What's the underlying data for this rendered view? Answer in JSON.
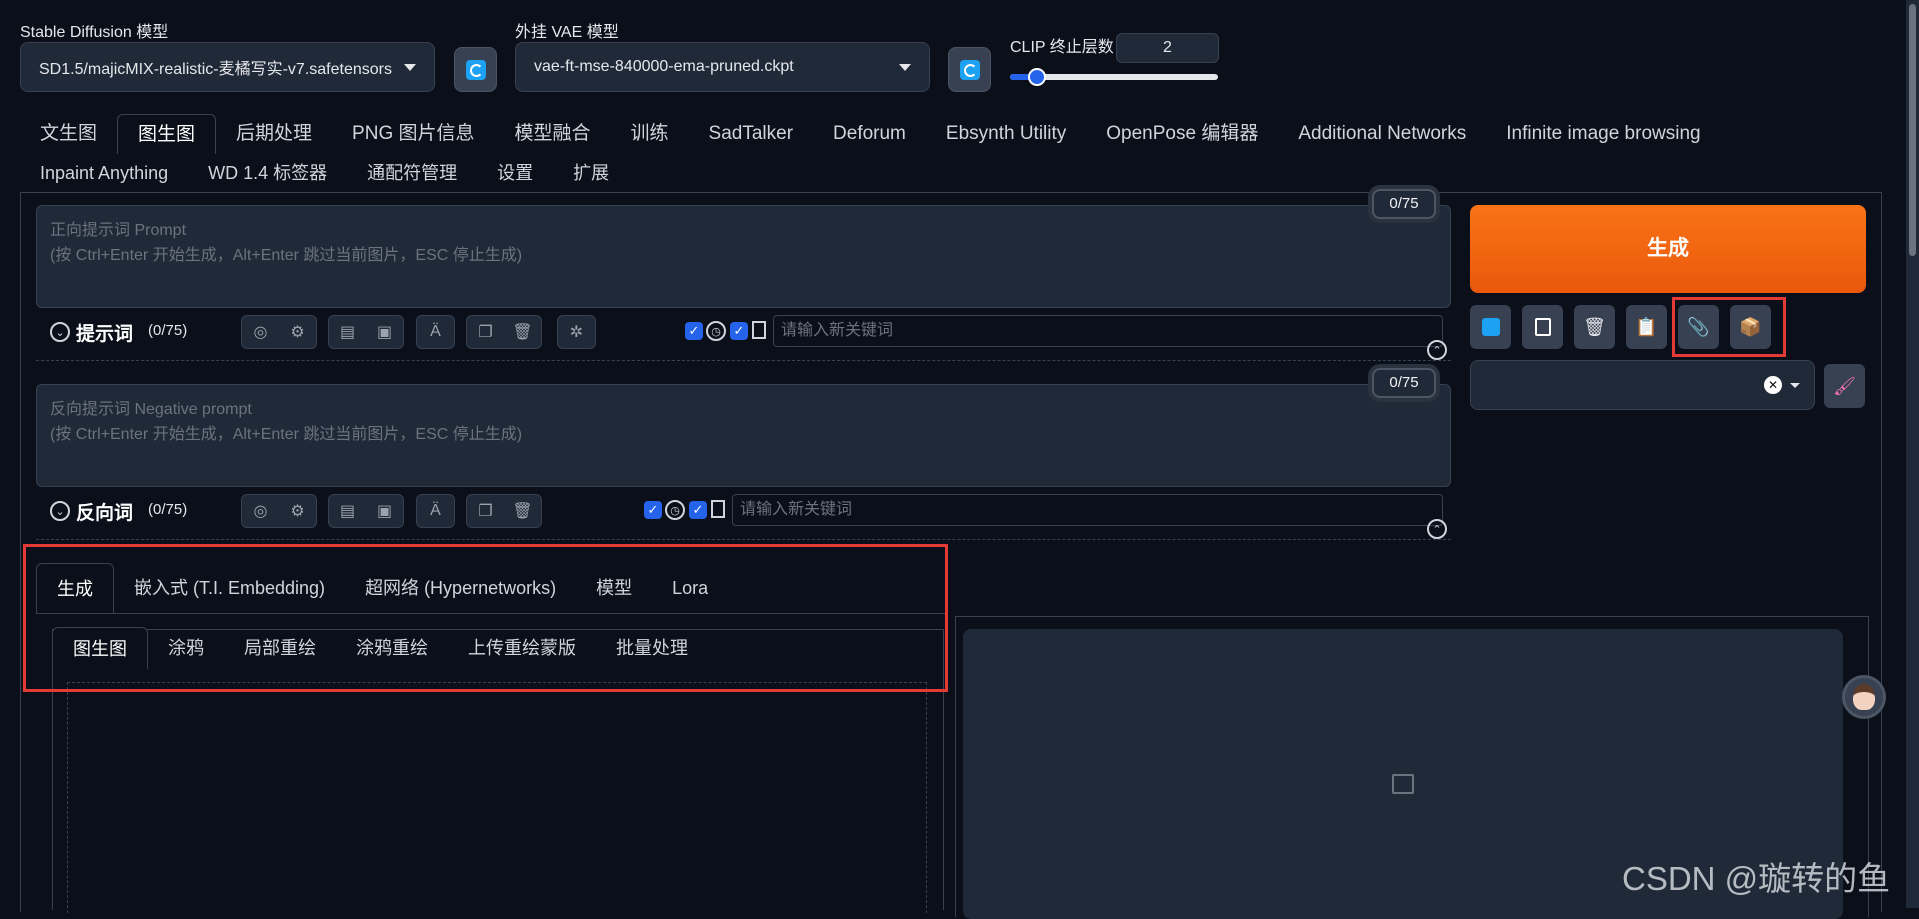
{
  "model": {
    "label": "Stable Diffusion 模型",
    "value": "SD1.5/majicMIX-realistic-麦橘写实-v7.safetensors"
  },
  "vae": {
    "label": "外挂 VAE 模型",
    "value": "vae-ft-mse-840000-ema-pruned.ckpt"
  },
  "clip": {
    "label": "CLIP 终止层数",
    "value": "2",
    "fraction": 0.13
  },
  "tabs_row1": [
    "文生图",
    "图生图",
    "后期处理",
    "PNG 图片信息",
    "模型融合",
    "训练",
    "SadTalker",
    "Deforum",
    "Ebsynth Utility",
    "OpenPose 编辑器",
    "Additional Networks",
    "Infinite image browsing"
  ],
  "tabs_row2": [
    "Inpaint Anything",
    "WD 1.4 标签器",
    "通配符管理",
    "设置",
    "扩展"
  ],
  "active_tab": "图生图",
  "prompt": {
    "placeholder_line1": "正向提示词 Prompt",
    "placeholder_line2": "(按 Ctrl+Enter 开始生成，Alt+Enter 跳过当前图片，ESC 停止生成)",
    "counter": "0/75",
    "title": "提示词",
    "count": "(0/75)",
    "keyword_placeholder": "请输入新关键词"
  },
  "negative": {
    "placeholder_line1": "反向提示词 Negative prompt",
    "placeholder_line2": "(按 Ctrl+Enter 开始生成，Alt+Enter 跳过当前图片，ESC 停止生成)",
    "counter": "0/75",
    "title": "反向词",
    "count": "(0/75)",
    "keyword_placeholder": "请输入新关键词"
  },
  "generate_label": "生成",
  "sub_tabs": [
    "生成",
    "嵌入式 (T.I. Embedding)",
    "超网络 (Hypernetworks)",
    "模型",
    "Lora"
  ],
  "mode_tabs": [
    "图生图",
    "涂鸦",
    "局部重绘",
    "涂鸦重绘",
    "上传重绘蒙版",
    "批量处理"
  ],
  "watermark": "CSDN @璇转的鱼",
  "colors": {
    "accent": "#ea580c",
    "highlight": "#e53935",
    "background": "#0b0f19"
  },
  "icons": [
    "refresh-icon",
    "globe-icon",
    "gear-icon",
    "history-icon",
    "bookmark-icon",
    "translate-icon",
    "copy-icon",
    "trash-icon",
    "openai-icon",
    "image-placeholder-icon"
  ]
}
